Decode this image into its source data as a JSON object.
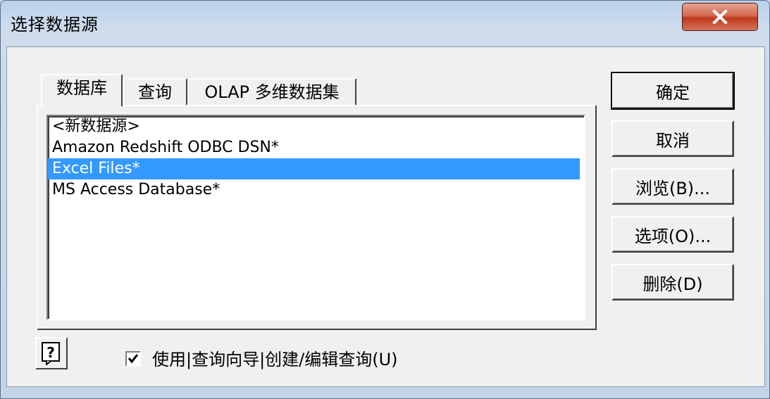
{
  "window": {
    "title": "选择数据源",
    "close_icon": "close-icon"
  },
  "tabs": [
    {
      "label": "数据库",
      "active": true
    },
    {
      "label": "查询",
      "active": false
    },
    {
      "label": "OLAP 多维数据集",
      "active": false
    }
  ],
  "list": {
    "items": [
      {
        "label": "<新数据源>",
        "selected": false
      },
      {
        "label": "Amazon Redshift ODBC DSN*",
        "selected": false
      },
      {
        "label": "Excel Files*",
        "selected": true
      },
      {
        "label": "MS Access Database*",
        "selected": false
      }
    ]
  },
  "buttons": {
    "ok": "确定",
    "cancel": "取消",
    "browse": "浏览(B)...",
    "options": "选项(O)...",
    "delete": "删除(D)"
  },
  "footer": {
    "help_icon": "help-icon",
    "wizard_checkbox_checked": true,
    "wizard_checkbox_label": "使用|查询向导|创建/编辑查询(U)"
  },
  "colors": {
    "selection": "#3399ff",
    "close_button": "#c0391b"
  }
}
